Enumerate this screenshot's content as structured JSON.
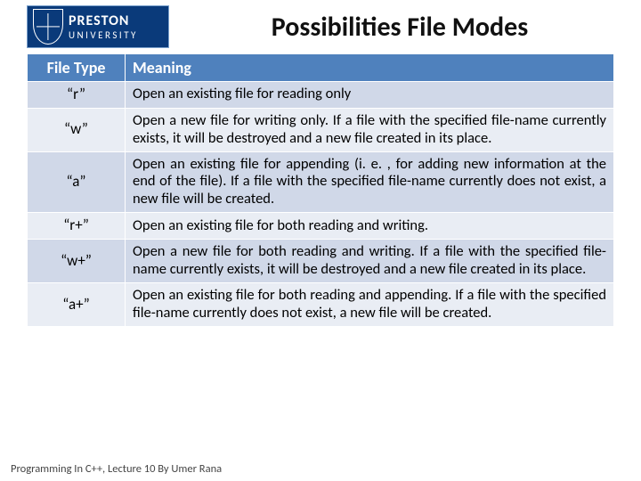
{
  "logo": {
    "line1": "PRESTON",
    "line2": "UNIVERSITY"
  },
  "title": "Possibilities File Modes",
  "table": {
    "headers": {
      "col1": "File Type",
      "col2": "Meaning"
    },
    "rows": [
      {
        "mode": "“r”",
        "meaning": "Open an existing file for reading only"
      },
      {
        "mode": "“w”",
        "meaning": "Open a new file for writing only. If a file with the specified file-name currently exists, it will be destroyed and a new file created in its place."
      },
      {
        "mode": "“a”",
        "meaning": "Open an existing file for appending (i. e. , for adding new information at the end of the file). If a file with the specified file-name currently does not exist, a new file will be created."
      },
      {
        "mode": "“r+”",
        "meaning": "Open an existing file for both reading and writing."
      },
      {
        "mode": "“w+”",
        "meaning": "Open a new file for both reading and writing. If a file with the specified file-name currently exists, it will be destroyed and a new file created in its place."
      },
      {
        "mode": "“a+”",
        "meaning": "Open an existing file for both reading and appending. If a file with the specified file-name currently does not exist, a new file will be created."
      }
    ]
  },
  "footer": "Programming In C++, Lecture 10 By Umer Rana"
}
